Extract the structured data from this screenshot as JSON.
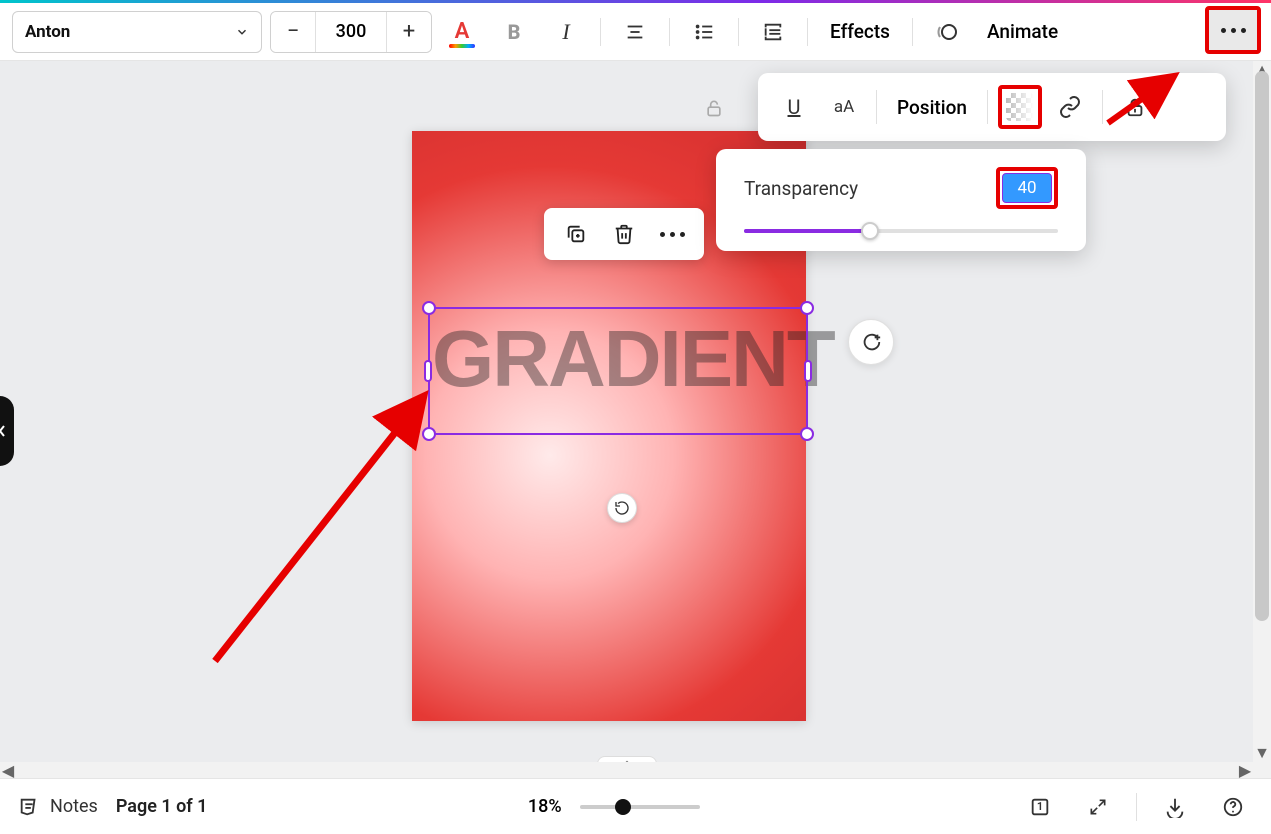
{
  "toolbar": {
    "font_name": "Anton",
    "font_size": "300",
    "effects_label": "Effects",
    "animate_label": "Animate"
  },
  "overflow": {
    "position_label": "Position"
  },
  "transparency": {
    "label": "Transparency",
    "value": "40",
    "percent": 40
  },
  "canvas": {
    "selected_text": "GRADIENT"
  },
  "bottom": {
    "notes_label": "Notes",
    "page_indicator": "Page 1 of 1",
    "zoom_label": "18%",
    "grid_count": "1"
  }
}
